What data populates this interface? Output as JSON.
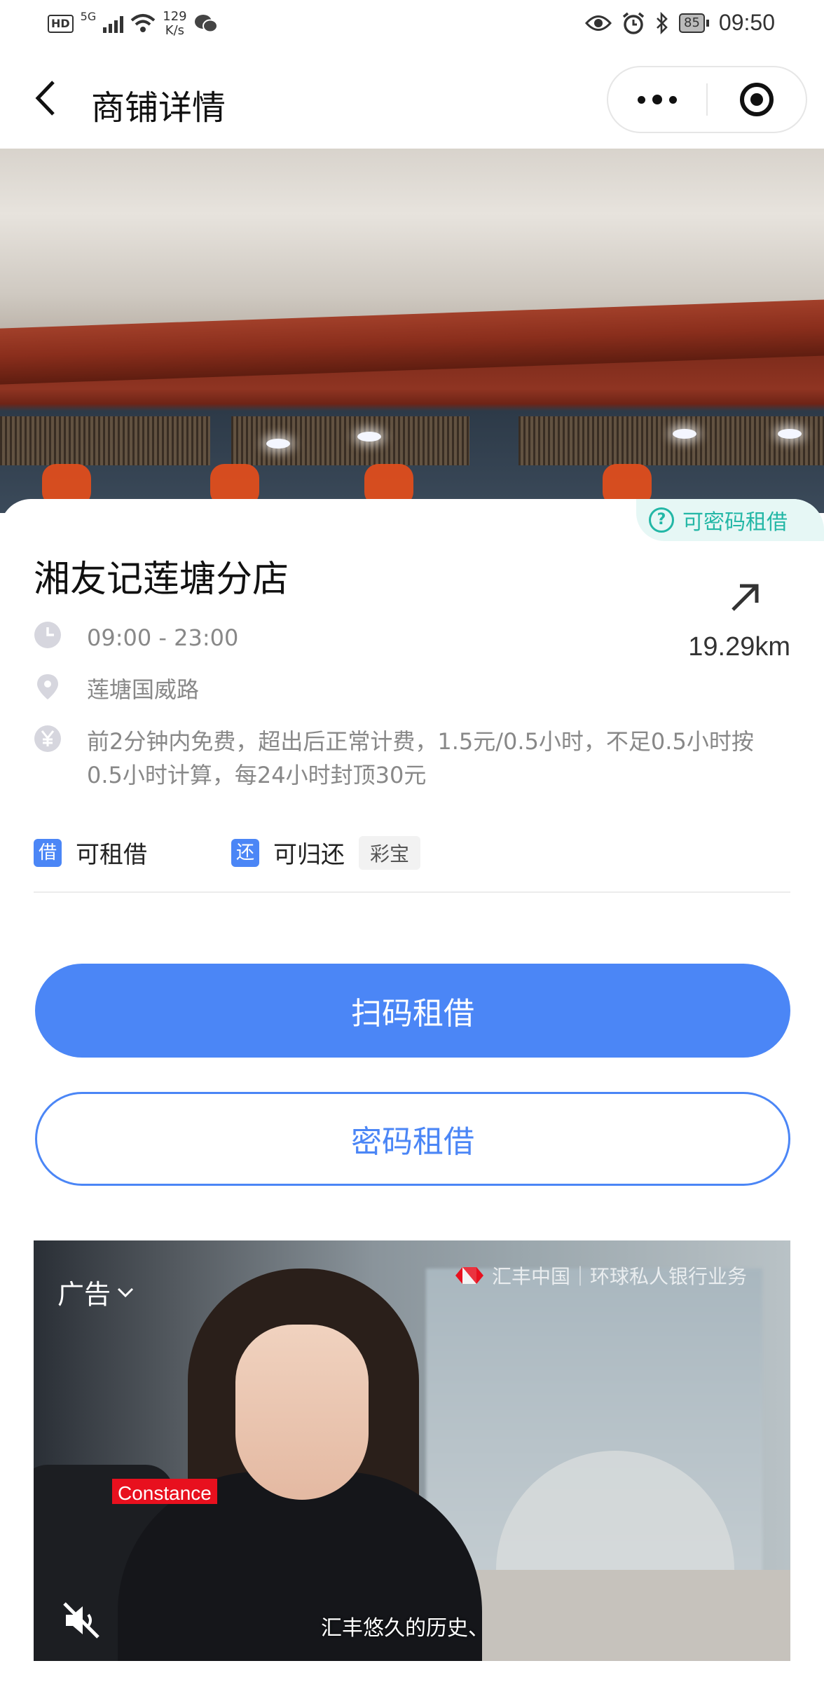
{
  "status_bar": {
    "hd": "HD",
    "network": "5G",
    "speed_value": "129",
    "speed_unit": "K/s",
    "battery": "85",
    "time": "09:50"
  },
  "nav": {
    "title": "商铺详情"
  },
  "store": {
    "password_tag": "可密码租借",
    "name": "湘友记莲塘分店",
    "distance": "19.29km",
    "hours": "09:00 - 23:00",
    "address": "莲塘国威路",
    "fee": "前2分钟内免费，超出后正常计费，1.5元/0.5小时，不足0.5小时按0.5小时计算，每24小时封顶30元",
    "borrow_badge": "借",
    "borrow_label": "可租借",
    "return_badge": "还",
    "return_label": "可归还",
    "return_chip": "彩宝"
  },
  "actions": {
    "scan_label": "扫码租借",
    "password_label": "密码租借"
  },
  "ad": {
    "label": "广告",
    "brand": "汇丰中国｜环球私人银行业务",
    "name_tag": "Constance",
    "caption": "汇丰悠久的历史、"
  },
  "colors": {
    "accent": "#4b86f6",
    "tag_teal": "#23b7a6",
    "ad_red": "#e8101e"
  }
}
